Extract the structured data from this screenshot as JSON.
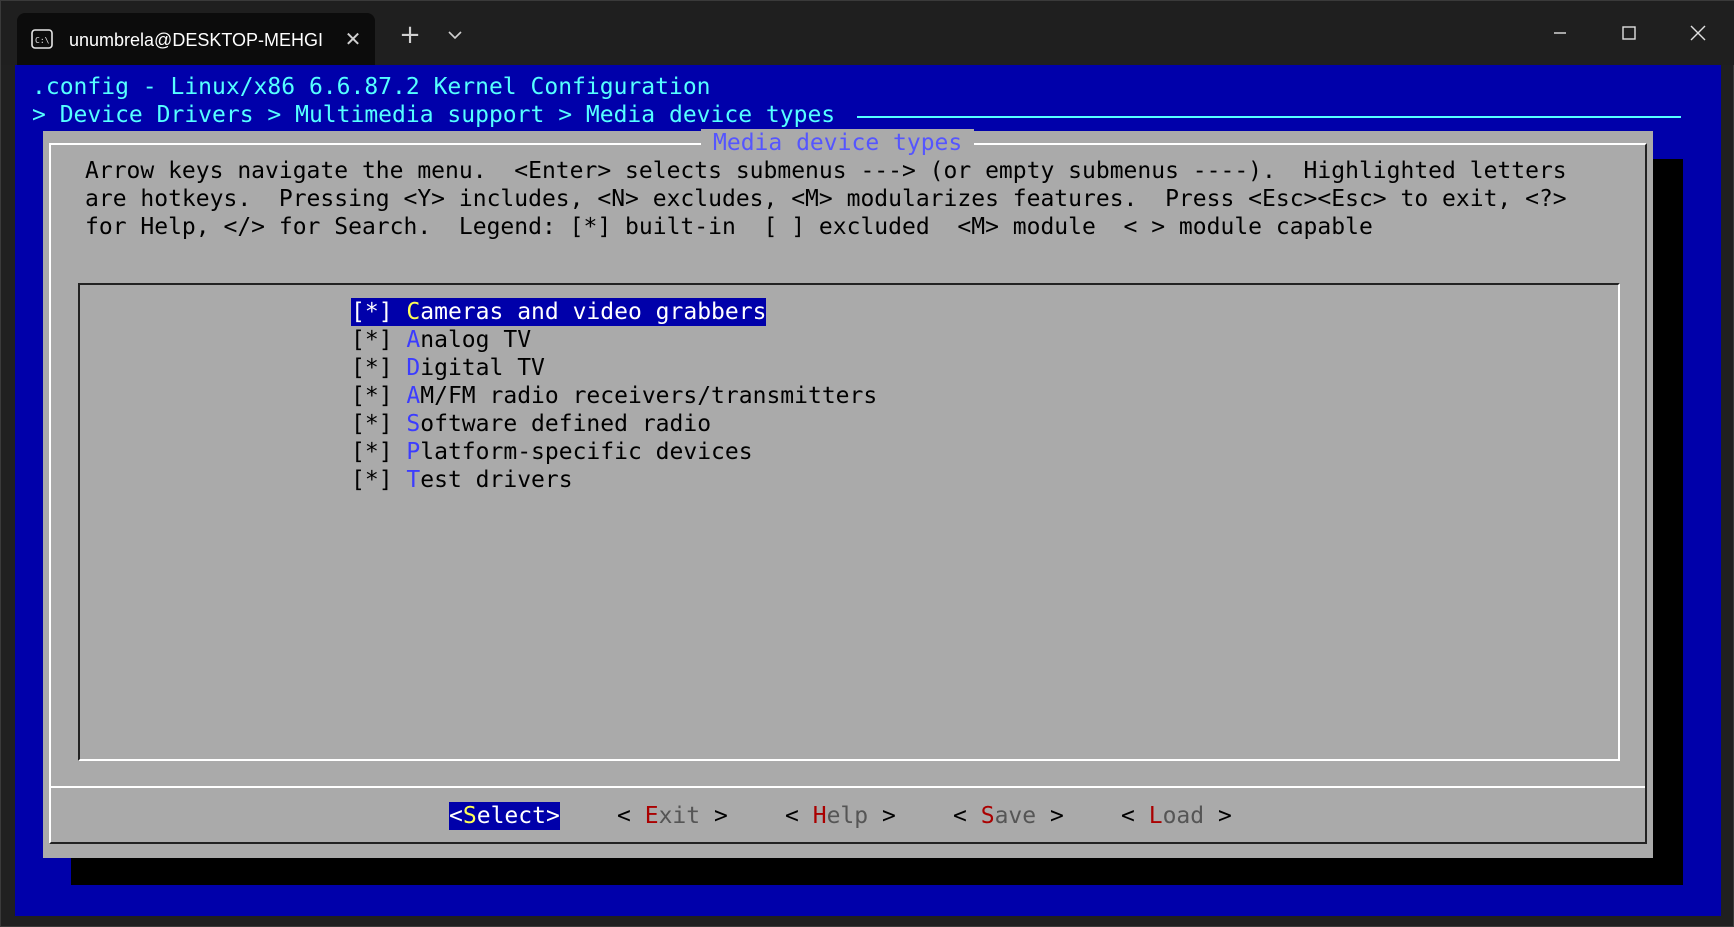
{
  "window": {
    "tab_title": "unumbrela@DESKTOP-MEHGI",
    "tab_icon": "terminal-icon",
    "close_tab_icon": "close-icon",
    "new_tab_icon": "plus-icon",
    "dropdown_icon": "chevron-down-icon",
    "controls": [
      "minimize-icon",
      "maximize-icon",
      "close-icon"
    ]
  },
  "terminal": {
    "config_title": ".config - Linux/x86 6.6.87.2 Kernel Configuration",
    "breadcrumb": "> Device Drivers > Multimedia support > Media device types",
    "dialog_title": "Media device types",
    "help_lines": [
      "Arrow keys navigate the menu.  <Enter> selects submenus ---> (or empty submenus ----).  Highlighted letters",
      "are hotkeys.  Pressing <Y> includes, <N> excludes, <M> modularizes features.  Press <Esc><Esc> to exit, <?>",
      "for Help, </> for Search.  Legend: [*] built-in  [ ] excluded  <M> module  < > module capable"
    ],
    "menu_items": [
      {
        "state": "[*]",
        "hotkey": "C",
        "rest": "ameras and video grabbers",
        "selected": true
      },
      {
        "state": "[*]",
        "hotkey": "A",
        "rest": "nalog TV",
        "selected": false
      },
      {
        "state": "[*]",
        "hotkey": "D",
        "rest": "igital TV",
        "selected": false
      },
      {
        "state": "[*]",
        "hotkey": "A",
        "rest": "M/FM radio receivers/transmitters",
        "selected": false
      },
      {
        "state": "[*]",
        "hotkey": "S",
        "rest": "oftware defined radio",
        "selected": false
      },
      {
        "state": "[*]",
        "hotkey": "P",
        "rest": "latform-specific devices",
        "selected": false
      },
      {
        "state": "[*]",
        "hotkey": "T",
        "rest": "est drivers",
        "selected": false
      }
    ],
    "buttons": {
      "select": {
        "open": "<",
        "hotkey": "S",
        "rest": "elect",
        "close": ">"
      },
      "exit": {
        "open": "< ",
        "hotkey": "E",
        "rest": "xit",
        "close": " >"
      },
      "help": {
        "open": "< ",
        "hotkey": "H",
        "rest": "elp",
        "close": " >"
      },
      "save": {
        "open": "< ",
        "hotkey": "S",
        "rest": "ave",
        "close": " >"
      },
      "load": {
        "open": "< ",
        "hotkey": "L",
        "rest": "oad",
        "close": " >"
      }
    }
  },
  "colors": {
    "terminal_bg": "#0000aa",
    "dialog_bg": "#aaaaaa",
    "title_cyan": "#55ffff",
    "hotkey_blue": "#3c3cff",
    "hotkey_red": "#aa0000",
    "selected_hotkey": "#ffff55"
  }
}
